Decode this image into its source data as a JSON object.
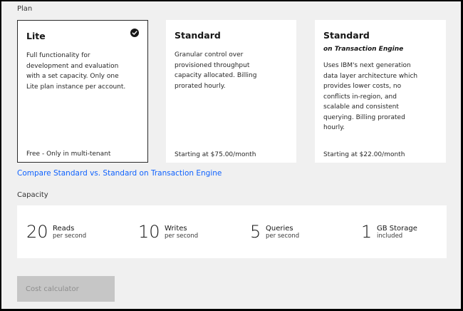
{
  "plan": {
    "section_label": "Plan",
    "cards": [
      {
        "title": "Lite",
        "subtitle": "",
        "description_lines": [
          "Full functionality for",
          "development and evaluation",
          "with a set capacity. Only one",
          "Lite plan instance per account."
        ],
        "price": "Free - Only in multi-tenant",
        "selected": true,
        "icon": "checkmark-filled-icon"
      },
      {
        "title": "Standard",
        "subtitle": "",
        "description_lines": [
          "Granular control over",
          "provisioned throughput",
          "capacity allocated. Billing",
          "prorated hourly."
        ],
        "price": "Starting at $75.00/month",
        "selected": false
      },
      {
        "title": "Standard",
        "subtitle": "on Transaction Engine",
        "description_lines": [
          "Uses IBM's next generation",
          "data layer architecture which",
          "provides lower costs, no",
          "conflicts in-region, and",
          "scalable and consistent",
          "querying. Billing prorated",
          "hourly."
        ],
        "price": "Starting at $22.00/month",
        "selected": false
      }
    ],
    "compare_link": "Compare Standard vs. Standard on Transaction Engine"
  },
  "capacity": {
    "section_label": "Capacity",
    "metrics": [
      {
        "value": "20",
        "name": "Reads",
        "sub": "per second"
      },
      {
        "value": "10",
        "name": "Writes",
        "sub": "per second"
      },
      {
        "value": "5",
        "name": "Queries",
        "sub": "per second"
      },
      {
        "value": "1",
        "name": "GB Storage",
        "sub": "included"
      }
    ]
  },
  "cost_calculator": {
    "label": "Cost calculator",
    "disabled": true
  },
  "colors": {
    "link": "#0f62fe",
    "card_border_selected": "#2a2a2a",
    "button_disabled": "#c6c6c6"
  }
}
